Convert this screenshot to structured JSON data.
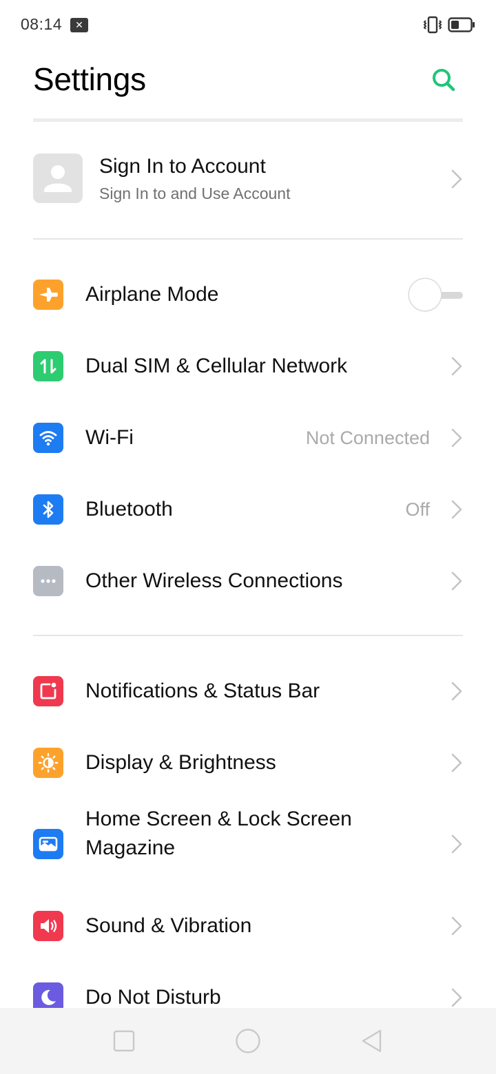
{
  "status_bar": {
    "time": "08:14",
    "notification_icon": "close-box-icon",
    "vibrate_icon": "vibrate-icon",
    "battery_icon": "battery-icon",
    "battery_level": 0.35
  },
  "header": {
    "title": "Settings",
    "search_icon": "search-icon",
    "accent_color": "#1fc57a"
  },
  "account": {
    "title": "Sign In to Account",
    "subtitle": "Sign In to and Use Account",
    "avatar_icon": "person-icon"
  },
  "sections": [
    {
      "items": [
        {
          "label": "Airplane Mode",
          "icon": "airplane-icon",
          "icon_color": "#fca22c",
          "control": "toggle",
          "toggle_on": false
        },
        {
          "label": "Dual SIM & Cellular Network",
          "icon": "cellular-data-icon",
          "icon_color": "#2ecc71",
          "control": "chevron"
        },
        {
          "label": "Wi-Fi",
          "icon": "wifi-icon",
          "icon_color": "#1e7cf2",
          "value": "Not Connected",
          "control": "chevron"
        },
        {
          "label": "Bluetooth",
          "icon": "bluetooth-icon",
          "icon_color": "#1e7cf2",
          "value": "Off",
          "control": "chevron"
        },
        {
          "label": "Other Wireless Connections",
          "icon": "more-dots-icon",
          "icon_color": "#b6bac2",
          "control": "chevron"
        }
      ]
    },
    {
      "items": [
        {
          "label": "Notifications & Status Bar",
          "icon": "notification-icon",
          "icon_color": "#f0394f",
          "control": "chevron"
        },
        {
          "label": "Display & Brightness",
          "icon": "brightness-icon",
          "icon_color": "#fca22c",
          "control": "chevron"
        },
        {
          "label": "Home Screen & Lock Screen Magazine",
          "icon": "wallpaper-icon",
          "icon_color": "#1e7cf2",
          "control": "chevron"
        },
        {
          "label": "Sound & Vibration",
          "icon": "speaker-icon",
          "icon_color": "#f0394f",
          "control": "chevron"
        },
        {
          "label": "Do Not Disturb",
          "icon": "moon-icon",
          "icon_color": "#6a5be0",
          "control": "chevron"
        }
      ]
    }
  ],
  "nav_bar": {
    "recents_icon": "square-recents-icon",
    "home_icon": "circle-home-icon",
    "back_icon": "triangle-back-icon"
  }
}
